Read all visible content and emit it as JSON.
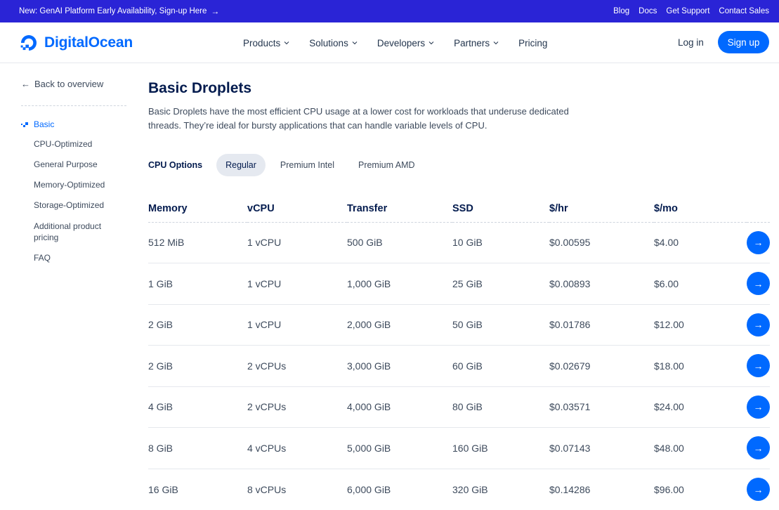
{
  "announcement": {
    "text": "New: GenAI Platform Early Availability, Sign-up Here",
    "arrow": "→",
    "links": [
      "Blog",
      "Docs",
      "Get Support",
      "Contact Sales"
    ]
  },
  "header": {
    "logo_text": "DigitalOcean",
    "nav": [
      "Products",
      "Solutions",
      "Developers",
      "Partners",
      "Pricing"
    ],
    "login": "Log in",
    "signup": "Sign up"
  },
  "sidebar": {
    "back": "Back to overview",
    "back_arrow": "←",
    "items": [
      "Basic",
      "CPU-Optimized",
      "General Purpose",
      "Memory-Optimized",
      "Storage-Optimized",
      "Additional product pricing",
      "FAQ"
    ]
  },
  "main": {
    "title": "Basic Droplets",
    "description": "Basic Droplets have the most efficient CPU usage at a lower cost for workloads that underuse dedicated threads. They’re ideal for bursty applications that can handle variable levels of CPU.",
    "cpu_label": "CPU Options",
    "tabs": [
      "Regular",
      "Premium Intel",
      "Premium AMD"
    ],
    "table": {
      "headers": [
        "Memory",
        "vCPU",
        "Transfer",
        "SSD",
        "$/hr",
        "$/mo"
      ],
      "rows": [
        [
          "512 MiB",
          "1 vCPU",
          "500 GiB",
          "10 GiB",
          "$0.00595",
          "$4.00"
        ],
        [
          "1 GiB",
          "1 vCPU",
          "1,000 GiB",
          "25 GiB",
          "$0.00893",
          "$6.00"
        ],
        [
          "2 GiB",
          "1 vCPU",
          "2,000 GiB",
          "50 GiB",
          "$0.01786",
          "$12.00"
        ],
        [
          "2 GiB",
          "2 vCPUs",
          "3,000 GiB",
          "60 GiB",
          "$0.02679",
          "$18.00"
        ],
        [
          "4 GiB",
          "2 vCPUs",
          "4,000 GiB",
          "80 GiB",
          "$0.03571",
          "$24.00"
        ],
        [
          "8 GiB",
          "4 vCPUs",
          "5,000 GiB",
          "160 GiB",
          "$0.07143",
          "$48.00"
        ],
        [
          "16 GiB",
          "8 vCPUs",
          "6,000 GiB",
          "320 GiB",
          "$0.14286",
          "$96.00"
        ]
      ],
      "row_action_icon": "→"
    }
  },
  "colors": {
    "brand": "#0069ff",
    "announce_bg": "#2a24d6",
    "text_dark": "#031b4e",
    "text_body": "#3d4a5c"
  },
  "icons": {
    "logo": "digitalocean-logo-icon",
    "chevron": "chevron-down-icon",
    "active_marker": "pixel-dots-icon",
    "row_action": "arrow-right-icon"
  }
}
